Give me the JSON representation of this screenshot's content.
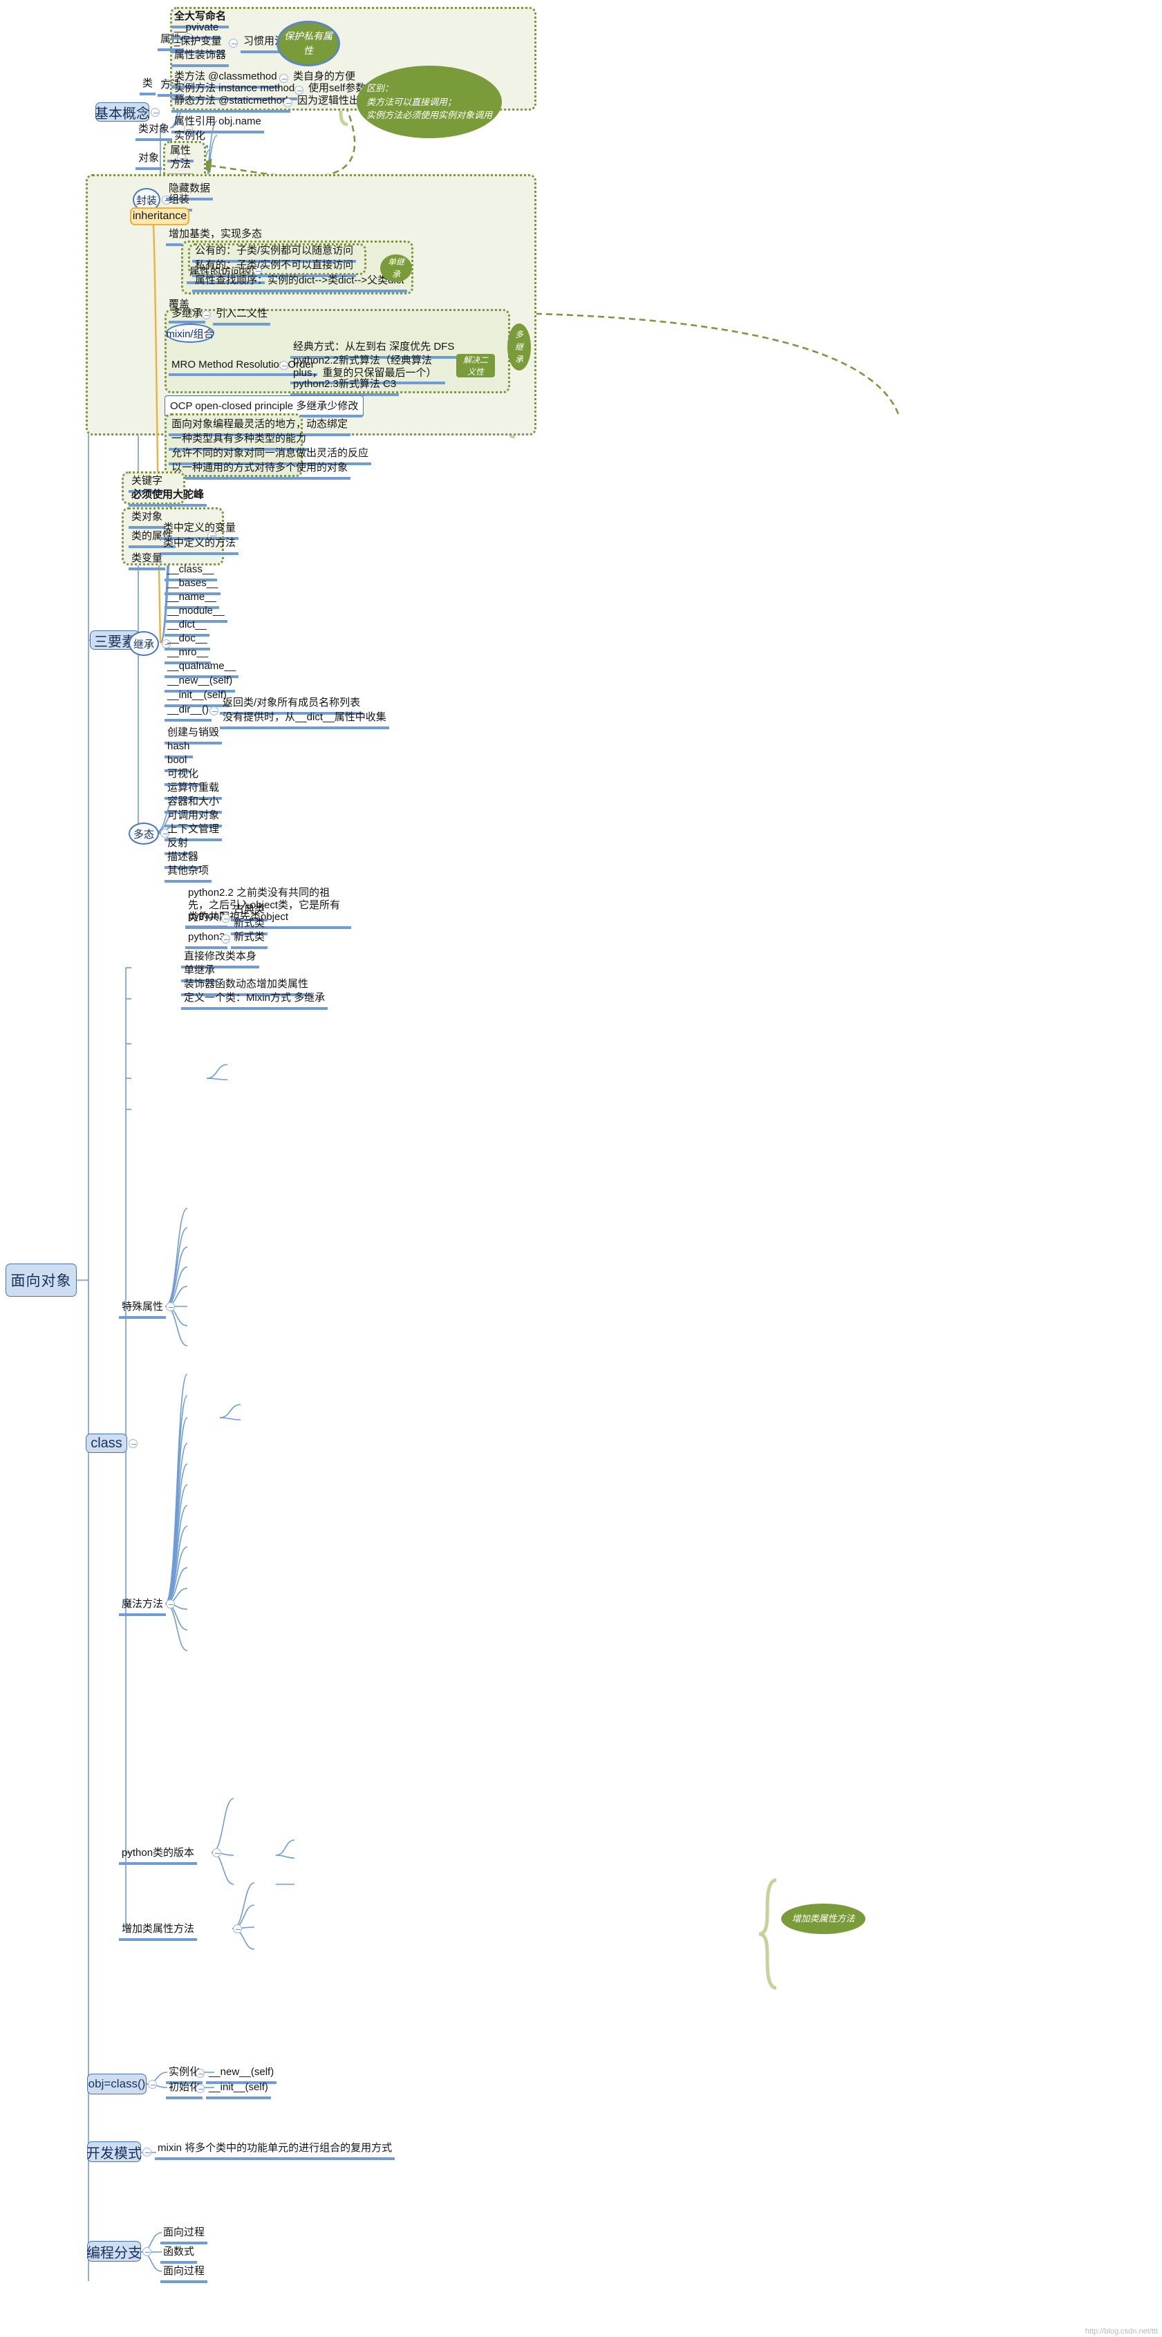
{
  "title": "面向对象",
  "colors": {
    "link": "#6f9cd4",
    "box_fill": "#cfddf0",
    "box_stroke": "#4a73ad",
    "green_fill": "#7a9b39",
    "dotted_border": "#7d9642",
    "dotted_fill": "#f0f3e5",
    "yellow_fill": "#fde7ad",
    "yellow_stroke": "#e8b33d"
  },
  "root": {
    "label": "面向对象"
  },
  "basic": {
    "label": "基本概念",
    "class": {
      "label": "类"
    },
    "attributes": {
      "label": "属性",
      "items": [
        {
          "label": "全大写命名",
          "bold": true
        },
        {
          "label": "__pvivate"
        },
        {
          "label": "_保护变量"
        },
        {
          "label": "属性装饰器"
        }
      ],
      "note": "习惯用法",
      "callout": "保护私有属性"
    },
    "methods": {
      "label": "方法",
      "items": [
        {
          "label": "类方法  @classmethod",
          "note": "类自身的方便"
        },
        {
          "label": "实例方法 instance method",
          "note": "使用self参数绑定到实例上"
        },
        {
          "label": "静态方法  @staticmethod",
          "note": "因为逻辑性出现的，仅仅是为了方便"
        }
      ],
      "callout": "区别：\n类方法可以直接调用；\n实例方法必须使用实例对象调用"
    },
    "class_object": {
      "label": "类对象",
      "items": [
        "属性引用 obj.name",
        "实例化"
      ]
    },
    "object": {
      "label": "对象",
      "items": [
        "属性",
        "方法"
      ]
    }
  },
  "three": {
    "label": "三要素",
    "encapsulation": {
      "label": "封装",
      "items": [
        "隐藏数据",
        "组装"
      ]
    },
    "inheritance_badge": "inheritance",
    "inheritance": {
      "label": "继承",
      "add_base": "增加基类，实现多态",
      "access_control": {
        "label": "属性的访问控制",
        "items": [
          "公有的：子类/实例都可以随意访问",
          "私有的：子类/实例不可以直接访问",
          "属性查找顺序：实例的dict-->类dict-->父类dict"
        ],
        "callout": "单继承"
      },
      "override": "覆盖",
      "multi": {
        "label": "多继承",
        "note": "引入二义性"
      },
      "mixin": "mixin/组合",
      "mro": {
        "label": "MRO Method Resolution Order",
        "items": [
          "经典方式：从左到右 深度优先 DFS",
          "python2.2新式算法（经典算法plus，重复的只保留最后一个）",
          "python2.3新式算法 C3"
        ],
        "callout_inner": "解决二义性",
        "callout_outer": "多继承"
      },
      "ocp": "OCP open-closed principle 多继承少修改"
    },
    "polymorphism": {
      "label": "多态",
      "items": [
        "面向对象编程最灵活的地方，动态绑定",
        "一种类型具有多种类型的能力",
        "允许不同的对象对同一消息做出灵活的反应",
        "以一种通用的方式对待多个使用的对象"
      ]
    }
  },
  "cls": {
    "label": "class",
    "keyword_group": [
      {
        "label": "关键字",
        "bold": false
      },
      {
        "label": "必须使用大驼峰",
        "bold": true
      }
    ],
    "class_obj_group": {
      "items": [
        "类对象",
        "类变量"
      ],
      "class_attr": {
        "label": "类的属性",
        "items": [
          "类中定义的变量",
          "类中定义的方法"
        ]
      }
    },
    "special_attrs": {
      "label": "特殊属性",
      "items": [
        "__class__",
        "__bases__",
        "__name__",
        "__module__",
        "__dict__",
        "__doc__",
        "__mro__",
        "__qualname__"
      ]
    },
    "magic_methods": {
      "label": "魔法方法",
      "items": [
        {
          "label": "__new__(self)"
        },
        {
          "label": "__init__(self)"
        },
        {
          "label": "__dir__()",
          "subs": [
            "返回类/对象所有成员名称列表",
            "没有提供时，从__dict__属性中收集"
          ]
        },
        {
          "label": "创建与销毁"
        },
        {
          "label": "hash"
        },
        {
          "label": "bool"
        },
        {
          "label": "可视化"
        },
        {
          "label": "运算符重载"
        },
        {
          "label": "容器和大小"
        },
        {
          "label": "可调用对象"
        },
        {
          "label": "上下文管理"
        },
        {
          "label": "反射"
        },
        {
          "label": "描述器"
        },
        {
          "label": "其他杂项"
        }
      ]
    },
    "versions": {
      "label": "python类的版本",
      "note": "python2.2 之前类没有共同的祖先，之后引入object类，它是所有类的共同祖先类object",
      "items": [
        {
          "label": "python2",
          "subs": [
            "古典类",
            "新式类"
          ]
        },
        {
          "label": "python3",
          "subs": [
            "新式类"
          ]
        }
      ]
    },
    "add_attr": {
      "label": "增加类属性方法",
      "items": [
        "直接修改类本身",
        "单继承",
        "装饰器函数动态增加类属性",
        "定义一个类：Mixin方式 多继承"
      ],
      "callout": "增加类属性方法"
    }
  },
  "objclass": {
    "label": "obj=class()",
    "rows": [
      {
        "label": "实例化",
        "value": "__new__(self)"
      },
      {
        "label": "初始化",
        "value": "__init__(self)"
      }
    ]
  },
  "devmode": {
    "label": "开发模式",
    "item": "mixin 将多个类中的功能单元的进行组合的复用方式"
  },
  "branch": {
    "label": "编程分支",
    "items": [
      "面向过程",
      "函数式",
      "面向过程"
    ]
  },
  "watermark": "http://blog.csdn.net/ttt"
}
